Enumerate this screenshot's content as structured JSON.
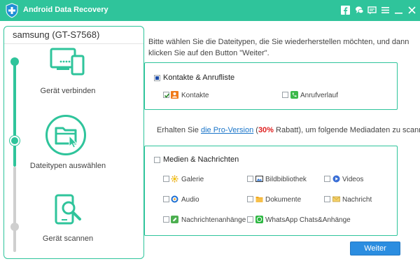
{
  "app": {
    "title": "Android Data Recovery",
    "accent_color": "#2fc49b"
  },
  "titlebar_icons": [
    "facebook-icon",
    "chat-icon",
    "feedback-icon",
    "menu-icon",
    "minimize-icon",
    "close-icon"
  ],
  "device": {
    "name": "samsung (GT-S7568)"
  },
  "steps": [
    {
      "label": "Gerät verbinden",
      "icon": "device-connect-icon",
      "state": "done"
    },
    {
      "label": "Dateitypen auswählen",
      "icon": "folder-select-icon",
      "state": "active"
    },
    {
      "label": "Gerät scannen",
      "icon": "phone-scan-icon",
      "state": "pending"
    }
  ],
  "instruction": "Bitte wählen Sie die Dateitypen, die Sie wiederherstellen möchten, und dann klicken Sie auf den Button \"Weiter\".",
  "contacts_group": {
    "label": "Kontakte & Anrufliste",
    "state": "partial",
    "items": [
      {
        "label": "Kontakte",
        "checked": true,
        "icon": "contacts-icon"
      },
      {
        "label": "Anrufverlauf",
        "checked": false,
        "icon": "call-log-icon"
      }
    ]
  },
  "pro_line": {
    "prefix": "Erhalten Sie ",
    "link": "die Pro-Version",
    "open_paren": " (",
    "percent": "30%",
    "suffix": " Rabatt), um folgende Mediadaten zu scannen."
  },
  "media_group": {
    "label": "Medien & Nachrichten",
    "state": "unchecked",
    "items": [
      {
        "label": "Galerie",
        "checked": false,
        "icon": "gallery-icon"
      },
      {
        "label": "Bildbibliothek",
        "checked": false,
        "icon": "picture-library-icon"
      },
      {
        "label": "Videos",
        "checked": false,
        "icon": "videos-icon"
      },
      {
        "label": "Audio",
        "checked": false,
        "icon": "audio-icon"
      },
      {
        "label": "Dokumente",
        "checked": false,
        "icon": "documents-icon"
      },
      {
        "label": "Nachricht",
        "checked": false,
        "icon": "message-icon"
      },
      {
        "label": "Nachrichtenanhänge",
        "checked": false,
        "icon": "message-attachments-icon"
      },
      {
        "label": "WhatsApp Chats&Anhänge",
        "checked": false,
        "icon": "whatsapp-icon"
      }
    ]
  },
  "next_button": {
    "label": "Weiter",
    "color": "#2b8de0"
  }
}
